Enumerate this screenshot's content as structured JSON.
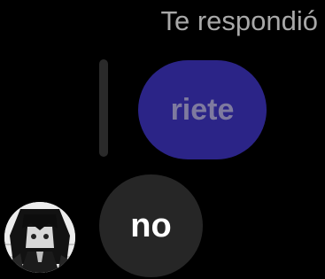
{
  "reply_header": {
    "text": "Te respondió"
  },
  "quoted_message": {
    "text": "riete",
    "bubble_color": "#2b2487",
    "text_color": "#7e7a9f"
  },
  "reply_indicator": {
    "color": "#2a2a2a"
  },
  "message": {
    "text": "no",
    "bubble_color": "#262626",
    "text_color": "#ffffff"
  },
  "sender": {
    "avatar_icon": "anime-character-avatar"
  }
}
